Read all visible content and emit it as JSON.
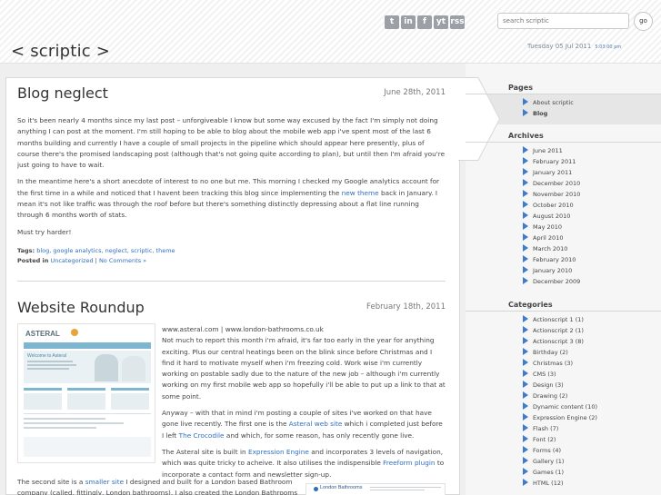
{
  "header": {
    "site_title": "< scriptic >",
    "search_placeholder": "search scriptic",
    "go_label": "go",
    "date": "Tuesday 05 Jul 2011",
    "time": "5:03:00 pm",
    "social_icons": [
      "t",
      "in",
      "f",
      "yt",
      "rss"
    ]
  },
  "posts": [
    {
      "title": "Blog neglect",
      "date": "June 28th, 2011",
      "p1": "So it's been nearly 4 months since my last post – unforgiveable I know but some way excused by the fact I'm simply not doing anything I can post at the moment. I'm still hoping to be able to blog about the mobile web app i've spent most of the last 6 months building and currently I have a couple of small projects in the pipeline which should appear here presently, plus of course there's the promised landscaping post (although that's not going quite according to plan), but until then I'm afraid you're just going to have to wait.",
      "p2_a": "In the meantime here's a short anecdote of interest to no one but me. This morning I checked my Google analytics account for the first time in a while and noticed that I havent been tracking this blog since implementing the ",
      "p2_link": "new theme",
      "p2_b": " back in January. I mean it's not like traffic was through the roof before but there's something distinctly depressing about a flat line running through 6 months worth of stats.",
      "p3": "Must try harder!",
      "tags_label": "Tags:",
      "tags": "blog, google analytics, neglect, scriptic, theme",
      "posted_label": "Posted in",
      "category": "Uncategorized",
      "separator": "|",
      "comments": "No Comments »"
    },
    {
      "title": "Website Roundup",
      "date": "February 18th, 2011",
      "head_1": "www.asteral.com",
      "head_sep": " | ",
      "head_2": "www.london-bathrooms.co.uk",
      "p1": "Not much to report this month i'm afraid, it's far too early in the year for anything exciting. Plus our central heatings been on the blink since before Christmas and I find it hard to motivate myself when i'm freezing cold. Work wise i'm currently working on postable sadly due to the nature of the new job – although i'm currently working on my first mobile web app so hopefully i'll be able to put up a link to that at some point.",
      "p2_a": "Anyway – with that in mind i'm posting a couple of sites i've worked on that have gone live recently. The first one is the ",
      "p2_link1": "Asteral web site",
      "p2_b": " which i completed just before I left ",
      "p2_link2": "The Crocodile",
      "p2_c": " and which, for some reason, has only recently gone live.",
      "p3_a": "The Asteral site is built in ",
      "p3_link1": "Expression Engine",
      "p3_b": " and incorporates 3 levels of navigation, which was quite tricky to acheive. It also utilises the indispensible ",
      "p3_link2": "Freeform plugin",
      "p3_c": " to incorporate a contact form and newsletter sign-up.",
      "p4_a": "The second site is a ",
      "p4_link": "smaller site",
      "p4_b": " I designed and built for a London based Bathroom company (called, fittingly, London bathrooms). I also created the London Bathrooms",
      "thumb1_brand": "ASTERAL",
      "thumb1_welcome": "Welcome to Asteral",
      "thumb2_brand": "London Bathrooms"
    }
  ],
  "sidebar": {
    "pages_title": "Pages",
    "pages": [
      "About scriptic",
      "Blog"
    ],
    "archives_title": "Archives",
    "archives": [
      "June 2011",
      "February 2011",
      "January 2011",
      "December 2010",
      "November 2010",
      "October 2010",
      "August 2010",
      "May 2010",
      "April 2010",
      "March 2010",
      "February 2010",
      "January 2010",
      "December 2009"
    ],
    "categories_title": "Categories",
    "categories": [
      "Actionscript 1 (1)",
      "Actionscript 2 (1)",
      "Actionscript 3 (8)",
      "Birthday (2)",
      "Christmas (3)",
      "CMS (3)",
      "Design (3)",
      "Drawing (2)",
      "Dynamic content (10)",
      "Expression Engine (2)",
      "Flash (7)",
      "Font (2)",
      "Forms (4)",
      "Gallery (1)",
      "Games (1)",
      "HTML (12)"
    ]
  },
  "colors": {
    "link": "#2f6fc0",
    "bullet": "#3d7cc9"
  }
}
